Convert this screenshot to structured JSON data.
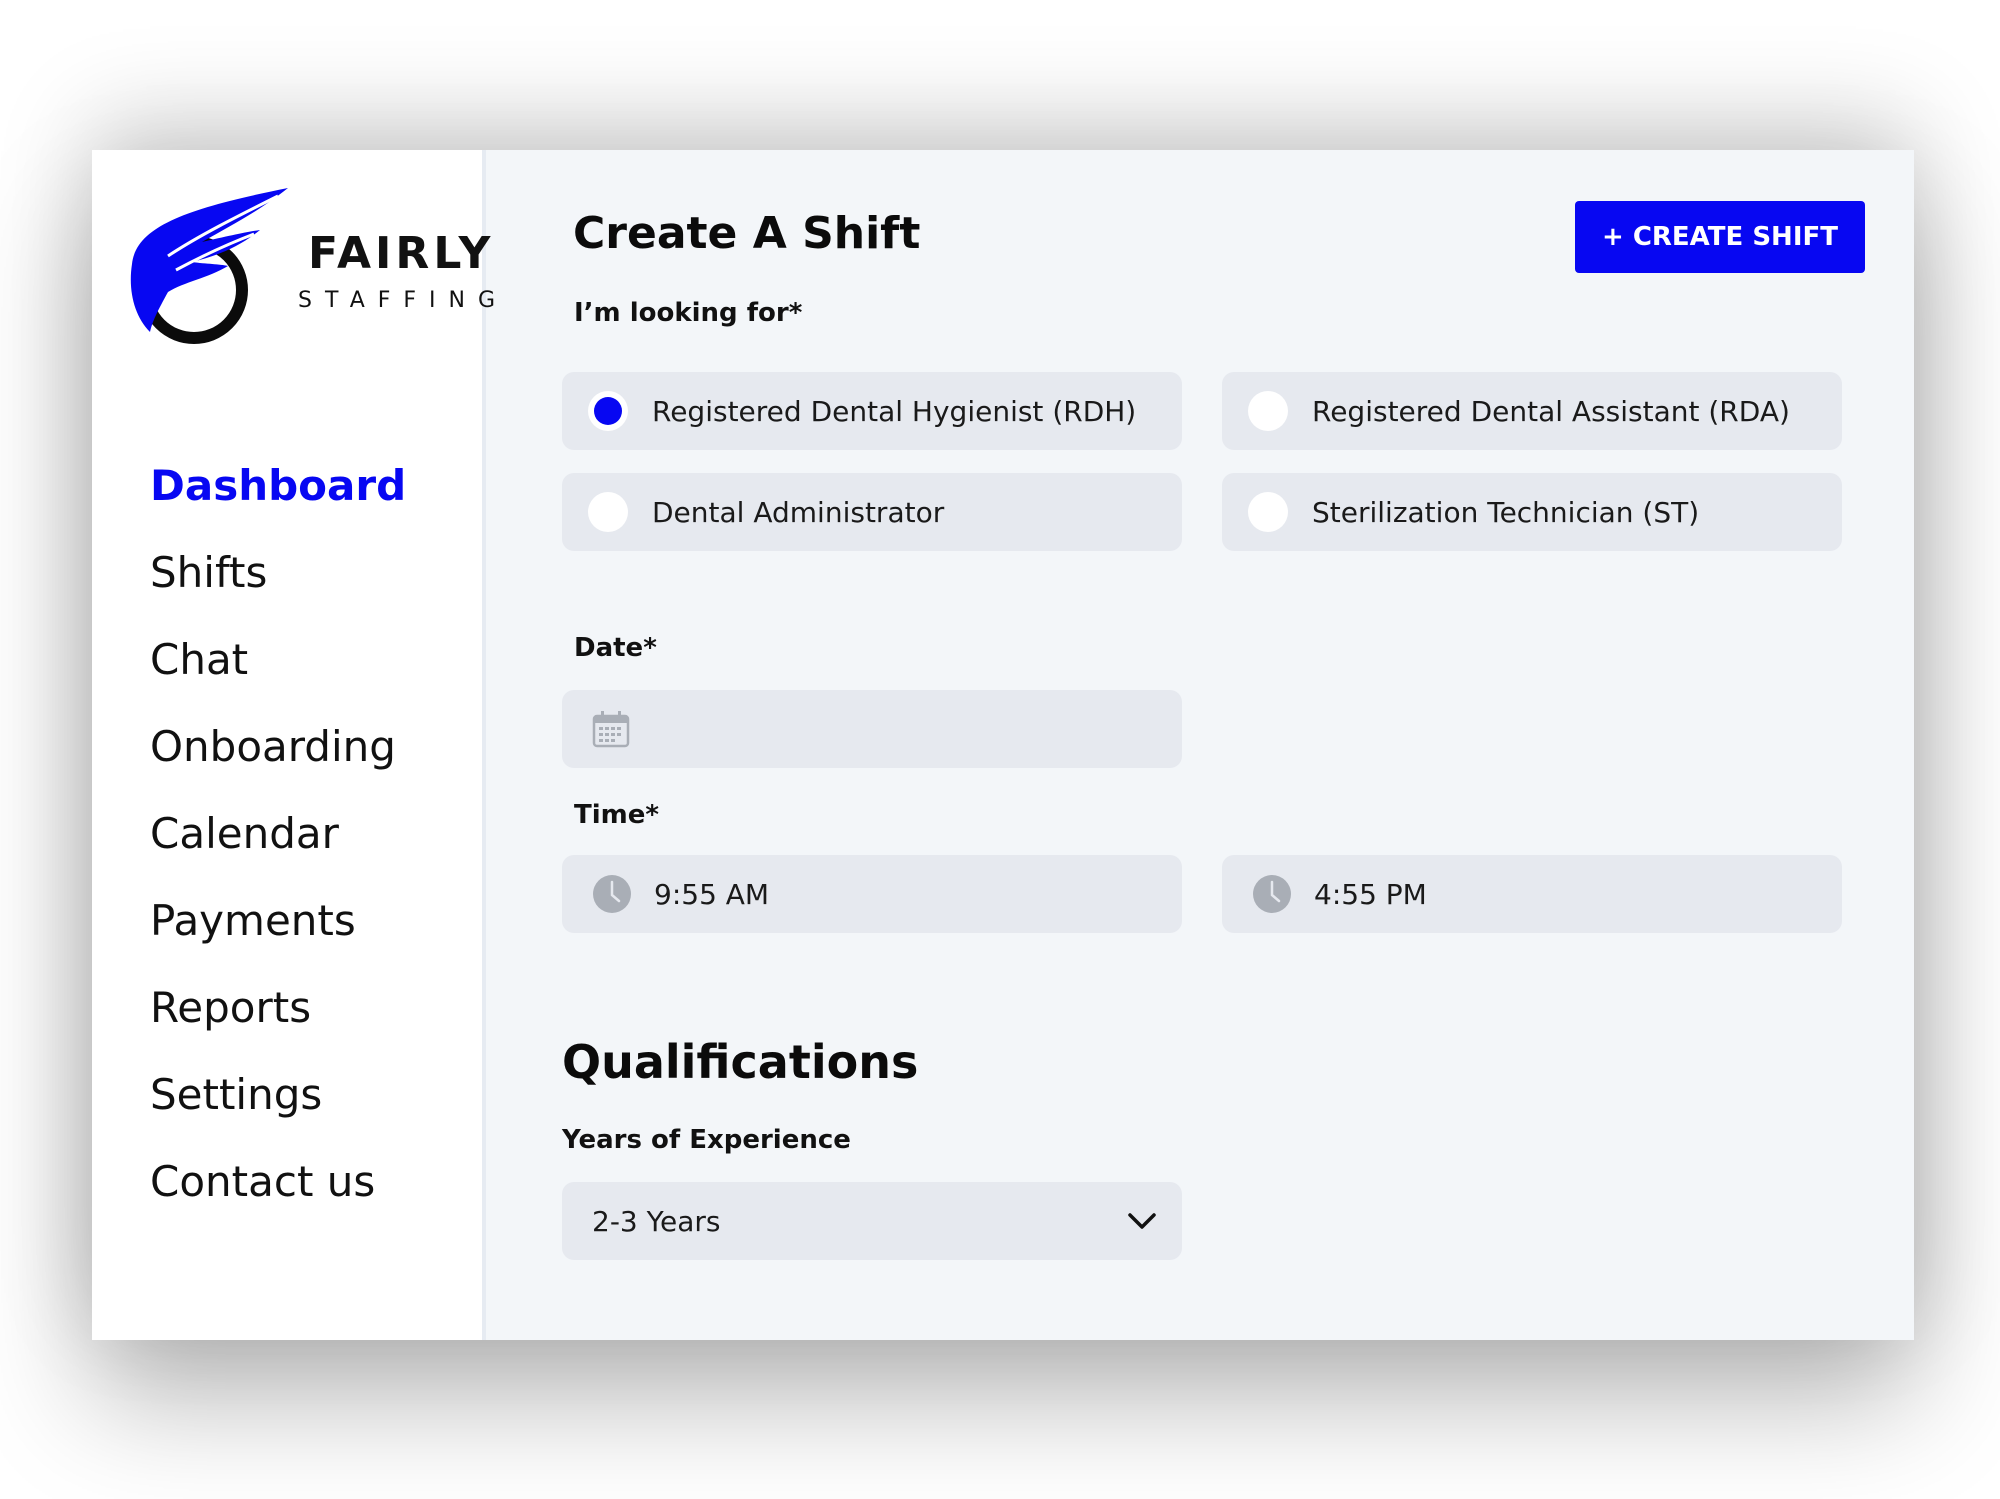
{
  "brand": {
    "name": "FAIRLY",
    "tagline": "STAFFING",
    "colors": {
      "accent": "#0707f2",
      "logo_ring": "#0b0b0b"
    }
  },
  "sidebar": {
    "items": [
      {
        "label": "Dashboard",
        "active": true
      },
      {
        "label": "Shifts",
        "active": false
      },
      {
        "label": "Chat",
        "active": false
      },
      {
        "label": "Onboarding",
        "active": false
      },
      {
        "label": "Calendar",
        "active": false
      },
      {
        "label": "Payments",
        "active": false
      },
      {
        "label": "Reports",
        "active": false
      },
      {
        "label": "Settings",
        "active": false
      },
      {
        "label": "Contact us",
        "active": false
      }
    ]
  },
  "main": {
    "title": "Create A Shift",
    "create_button": "+ CREATE SHIFT",
    "looking_for": {
      "label": "I’m looking for*",
      "options": [
        {
          "label": "Registered Dental Hygienist (RDH)",
          "selected": true
        },
        {
          "label": "Registered Dental Assistant (RDA)",
          "selected": false
        },
        {
          "label": "Dental Administrator",
          "selected": false
        },
        {
          "label": "Sterilization Technician (ST)",
          "selected": false
        }
      ]
    },
    "date": {
      "label": "Date*",
      "value": "",
      "icon": "calendar-icon"
    },
    "time": {
      "label": "Time*",
      "start": "9:55 AM",
      "end": "4:55 PM",
      "icon": "clock-icon"
    },
    "qualifications": {
      "title": "Qualifications",
      "experience_label": "Years of Experience",
      "experience_value": "2-3 Years",
      "icon": "chevron-down-icon"
    }
  }
}
